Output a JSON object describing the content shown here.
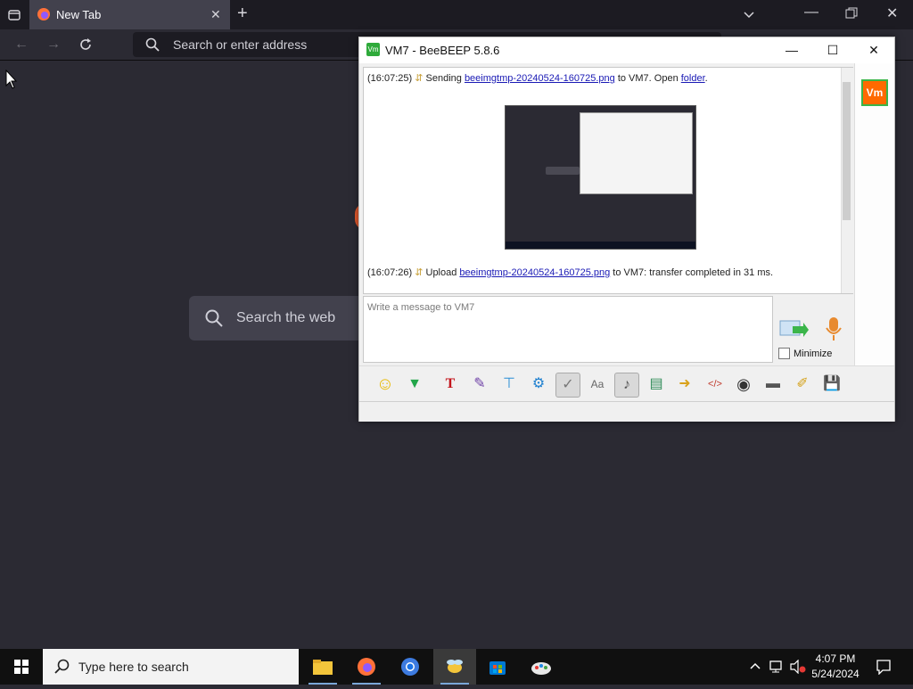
{
  "browser": {
    "tab_title": "New Tab",
    "address_placeholder": "Search or enter address",
    "newtab_search_placeholder": "Search the web",
    "icons": [
      "tab-list-icon",
      "firefox-icon",
      "close-icon",
      "new-tab-icon",
      "chevron-down-icon",
      "minimize-icon",
      "restore-icon",
      "close-window-icon",
      "back-icon",
      "forward-icon",
      "reload-icon",
      "search-icon"
    ]
  },
  "beebeep": {
    "title": "VM7 - BeeBEEP 5.8.6",
    "messages": [
      {
        "time": "(16:07:25)",
        "prefix": "Sending",
        "file": "beeimgtmp-20240524-160725.png",
        "middle": "to VM7. Open",
        "link": "folder",
        "suffix": "."
      },
      {
        "time": "(16:07:26)",
        "prefix": "Upload",
        "file": "beeimgtmp-20240524-160725.png",
        "middle": "to VM7: transfer completed in 31 ms.",
        "link": "",
        "suffix": ""
      }
    ],
    "compose_placeholder": "Write a message to VM7",
    "minimize_label": "Minimize",
    "user_badge": "Vm",
    "toolbar_icons": [
      "emoticon-icon",
      "text-down-icon",
      "font-icon",
      "color-picker-icon",
      "filter-icon",
      "settings-gear-icon",
      "spellcheck-icon",
      "text-box-icon",
      "compact-icon",
      "file-icon",
      "send-file-icon",
      "folder-send-icon",
      "html-icon",
      "screenshot-icon",
      "terminal-icon",
      "notes-icon",
      "save-icon"
    ],
    "accent_color": "#2eaa3a",
    "user_color": "#ff6a00"
  },
  "taskbar": {
    "search_placeholder": "Type here to search",
    "time": "4:07 PM",
    "date": "5/24/2024",
    "apps": [
      "file-explorer-icon",
      "firefox-icon",
      "chrome-icon",
      "beebeep-icon",
      "store-icon",
      "paint-icon"
    ]
  }
}
